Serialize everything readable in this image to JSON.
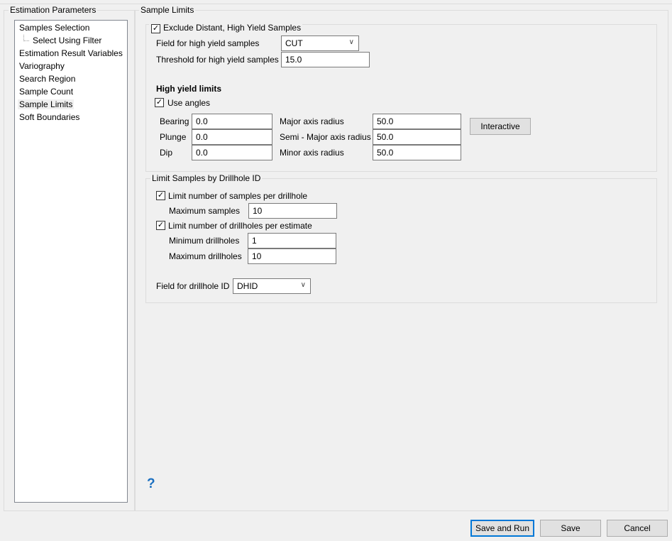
{
  "left_panel": {
    "title": "Estimation Parameters",
    "items": [
      {
        "label": "Samples Selection"
      },
      {
        "label": "Select Using Filter"
      },
      {
        "label": "Estimation Result Variables"
      },
      {
        "label": "Variography"
      },
      {
        "label": "Search Region"
      },
      {
        "label": "Sample Count"
      },
      {
        "label": "Sample Limits"
      },
      {
        "label": "Soft Boundaries"
      }
    ],
    "selected": "Sample Limits"
  },
  "main": {
    "title": "Sample Limits",
    "exclude": {
      "label": "Exclude Distant, High Yield Samples",
      "checked": true,
      "field_label": "Field for high yield samples",
      "field_value": "CUT",
      "threshold_label": "Threshold for high yield samples",
      "threshold_value": "15.0",
      "limits_heading": "High yield limits",
      "use_angles_label": "Use angles",
      "use_angles_checked": true,
      "bearing_label": "Bearing",
      "bearing": "0.0",
      "plunge_label": "Plunge",
      "plunge": "0.0",
      "dip_label": "Dip",
      "dip": "0.0",
      "major_label": "Major axis radius",
      "major": "50.0",
      "semi_label": "Semi - Major axis radius",
      "semi": "50.0",
      "minor_label": "Minor axis radius",
      "minor": "50.0",
      "interactive_label": "Interactive"
    },
    "drillhole": {
      "title": "Limit Samples by Drillhole ID",
      "per_hole_label": "Limit number of samples per drillhole",
      "per_hole_checked": true,
      "max_samples_label": "Maximum samples",
      "max_samples": "10",
      "per_est_label": "Limit number of drillholes per estimate",
      "per_est_checked": true,
      "min_holes_label": "Minimum drillholes",
      "min_holes": "1",
      "max_holes_label": "Maximum drillholes",
      "max_holes": "10",
      "field_label": "Field for drillhole ID",
      "field_value": "DHID"
    },
    "help": "?"
  },
  "footer": {
    "save_run": "Save and Run",
    "save": "Save",
    "cancel": "Cancel"
  },
  "colors": {
    "accent": "#0078d7",
    "help": "#1a6fc0"
  }
}
